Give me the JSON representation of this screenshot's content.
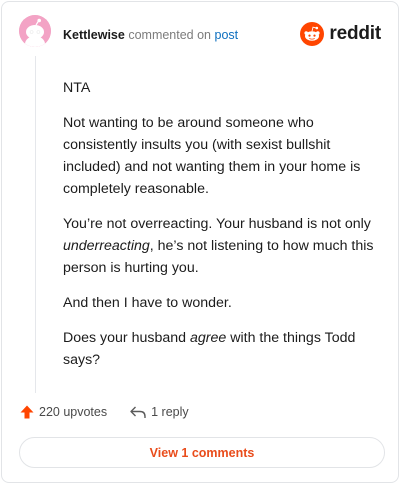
{
  "comment": {
    "author": "Kettlewise",
    "action_text": "commented on",
    "target_link": "post",
    "avatar_icon": "snoo-avatar-icon",
    "paragraphs": [
      [
        {
          "t": "NTA"
        }
      ],
      [
        {
          "t": "Not wanting to be around someone who consistently insults you (with sexist bullshit included) and not wanting them in your home is completely reasonable."
        }
      ],
      [
        {
          "t": "You’re not overreacting. Your husband is not only "
        },
        {
          "t": "underreacting",
          "em": true
        },
        {
          "t": ", he’s not listening to how much this person is hurting you."
        }
      ],
      [
        {
          "t": "And then I have to wonder."
        }
      ],
      [
        {
          "t": "Does your husband "
        },
        {
          "t": "agree",
          "em": true
        },
        {
          "t": " with the things Todd says?"
        }
      ]
    ]
  },
  "brand": {
    "wordmark": "reddit",
    "icon": "reddit-snoo-icon",
    "color": "#ff4500"
  },
  "actions": {
    "upvotes": "220 upvotes",
    "upvote_icon": "upvote-arrow-icon",
    "replies": "1 reply",
    "reply_icon": "reply-arrow-icon"
  },
  "view_button": {
    "label": "View 1 comments"
  },
  "colors": {
    "link": "#0d6fbf",
    "accent": "#e94c1b",
    "border": "#e2e4e7"
  }
}
